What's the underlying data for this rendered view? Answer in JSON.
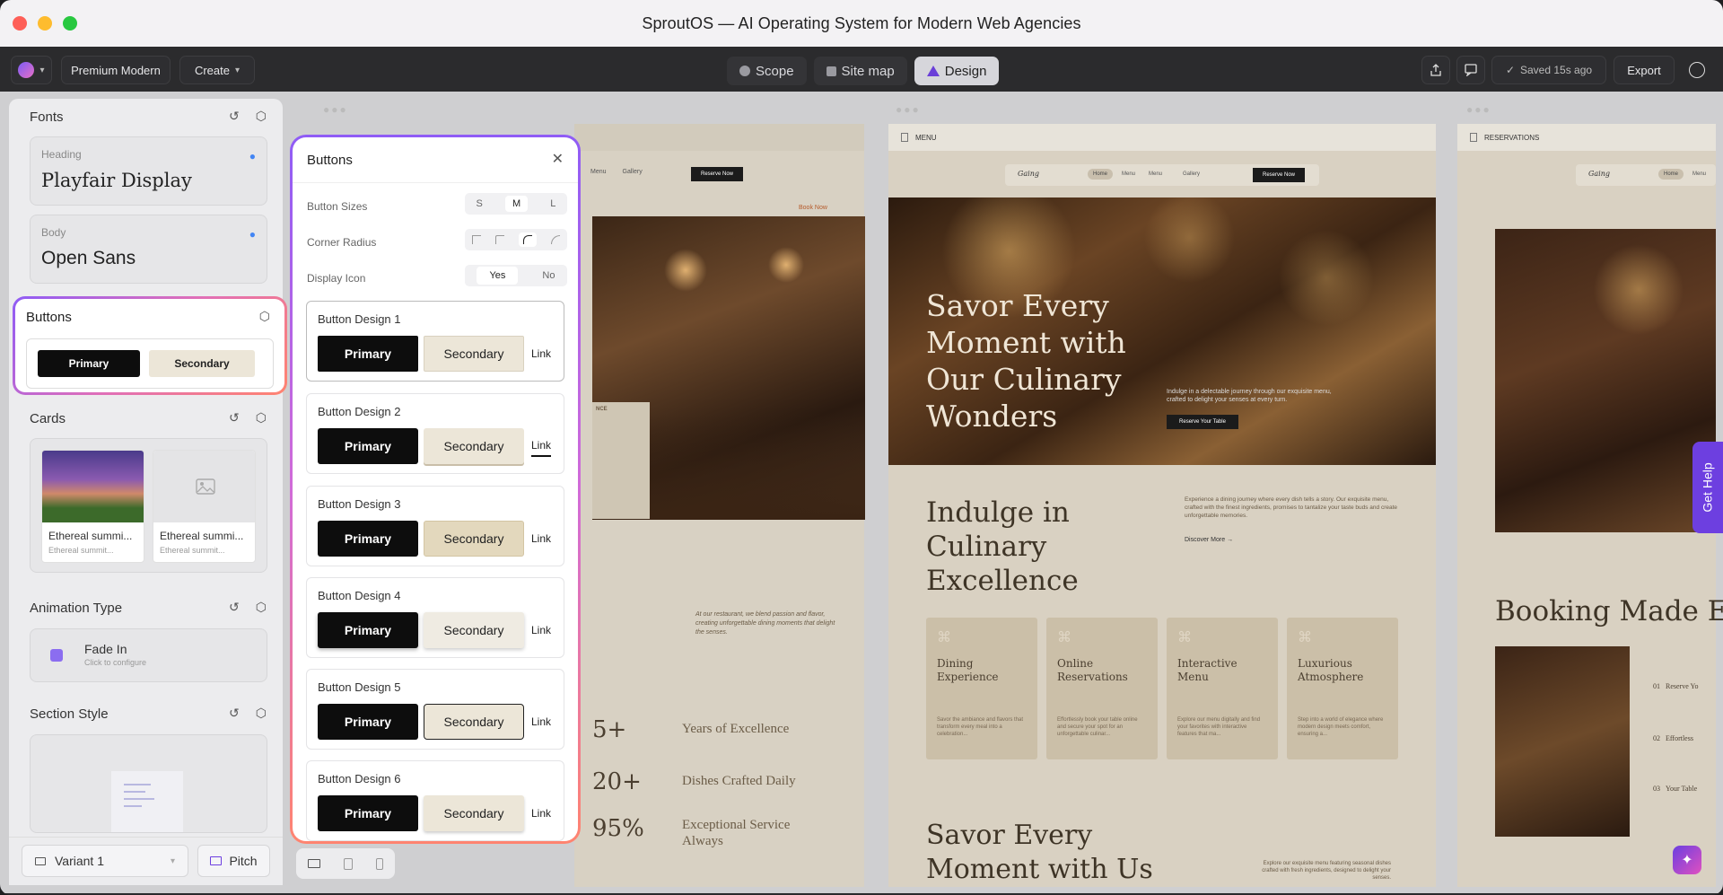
{
  "window": {
    "title": "SproutOS — AI Operating System for Modern Web Agencies"
  },
  "toolbar": {
    "theme_label": "Premium Modern",
    "create_label": "Create",
    "tabs": [
      {
        "label": "Scope"
      },
      {
        "label": "Site map"
      },
      {
        "label": "Design"
      }
    ],
    "saved_label": "Saved 15s ago",
    "export_label": "Export"
  },
  "left_panel": {
    "fonts": {
      "title": "Fonts",
      "heading_caption": "Heading",
      "heading_font": "Playfair Display",
      "body_caption": "Body",
      "body_font": "Open Sans"
    },
    "buttons": {
      "title": "Buttons",
      "primary": "Primary",
      "secondary": "Secondary"
    },
    "cards": {
      "title": "Cards",
      "items": [
        {
          "title": "Ethereal summi...",
          "subtitle": "Ethereal summit..."
        },
        {
          "title": "Ethereal summi...",
          "subtitle": "Ethereal summit..."
        }
      ]
    },
    "animation": {
      "title": "Animation Type",
      "value": "Fade In",
      "hint": "Click to configure"
    },
    "section_style": {
      "title": "Section Style"
    },
    "footer": {
      "variant": "Variant 1",
      "pitch": "Pitch"
    }
  },
  "popup": {
    "title": "Buttons",
    "sizes_label": "Button Sizes",
    "sizes": [
      "S",
      "M",
      "L"
    ],
    "size_selected": "M",
    "radius_label": "Corner Radius",
    "icon_label": "Display Icon",
    "icon_options": [
      "Yes",
      "No"
    ],
    "icon_selected": "Yes",
    "designs": [
      {
        "label": "Button Design 1",
        "primary": "Primary",
        "secondary": "Secondary",
        "link": "Link"
      },
      {
        "label": "Button Design 2",
        "primary": "Primary",
        "secondary": "Secondary",
        "link": "Link"
      },
      {
        "label": "Button Design 3",
        "primary": "Primary",
        "secondary": "Secondary",
        "link": "Link"
      },
      {
        "label": "Button Design 4",
        "primary": "Primary",
        "secondary": "Secondary",
        "link": "Link"
      },
      {
        "label": "Button Design 5",
        "primary": "Primary",
        "secondary": "Secondary",
        "link": "Link"
      },
      {
        "label": "Button Design 6",
        "primary": "Primary",
        "secondary": "Secondary",
        "link": "Link"
      }
    ]
  },
  "page1": {
    "nav": [
      "Menu",
      "Gallery"
    ],
    "cta": "Reserve Now",
    "book_now": "Book Now",
    "body_copy": "At our restaurant, we blend passion and flavor, creating unforgettable dining moments that delight the senses.",
    "stats": [
      {
        "value": "5+",
        "label": "Years of Excellence"
      },
      {
        "value": "20+",
        "label": "Dishes Crafted Daily"
      },
      {
        "value": "95%",
        "label": "Exceptional Service Always"
      }
    ]
  },
  "page2": {
    "tab_label": "MENU",
    "logo": "Gaing",
    "nav": [
      "Home",
      "Menu",
      "Menu",
      "Gallery"
    ],
    "cta": "Reserve Now",
    "hero_title": "Savor Every Moment with Our Culinary Wonders",
    "hero_copy": "Indulge in a delectable journey through our exquisite menu, crafted to delight your senses at every turn.",
    "hero_cta": "Reserve Your Table",
    "section_title": "Indulge in Culinary Excellence",
    "section_copy": "Experience a dining journey where every dish tells a story. Our exquisite menu, crafted with the finest ingredients, promises to tantalize your taste buds and create unforgettable memories.",
    "discover": "Discover More →",
    "features": [
      {
        "title": "Dining Experience",
        "copy": "Savor the ambiance and flavors that transform every meal into a celebration..."
      },
      {
        "title": "Online Reservations",
        "copy": "Effortlessly book your table online and secure your spot for an unforgettable culinar..."
      },
      {
        "title": "Interactive Menu",
        "copy": "Explore our menu digitally and find your favorites with interactive features that ma..."
      },
      {
        "title": "Luxurious Atmosphere",
        "copy": "Step into a world of elegance where modern design meets comfort, ensuring a..."
      }
    ],
    "bottom_title": "Savor Every Moment with Us",
    "bottom_copy": "Explore our exquisite menu featuring seasonal dishes crafted with fresh ingredients, designed to delight your senses."
  },
  "page3": {
    "tab_label": "RESERVATIONS",
    "logo": "Gaing",
    "nav": [
      "Home",
      "Menu"
    ],
    "title": "Booking Made Eas",
    "steps": [
      {
        "n": "01",
        "label": "Reserve Yo"
      },
      {
        "n": "02",
        "label": "Effortless"
      },
      {
        "n": "03",
        "label": "Your Table"
      }
    ]
  },
  "help": {
    "label": "Get Help"
  },
  "colors": {
    "accent": "#8b5cf6",
    "primary_button": "#0d0d0d",
    "secondary_button": "#ece6d8",
    "help_tab": "#6d3fe0"
  }
}
